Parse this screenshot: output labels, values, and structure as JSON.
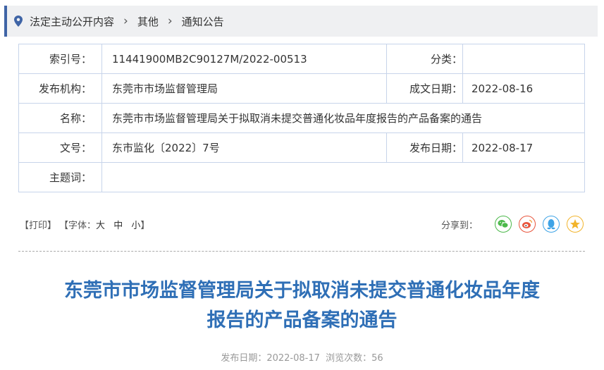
{
  "breadcrumb": [
    "法定主动公开内容",
    "其他",
    "通知公告"
  ],
  "meta": {
    "index_label": "索引号：",
    "index_value": "11441900MB2C90127M/2022-00513",
    "category_label": "分类：",
    "category_value": "",
    "publisher_label": "发布机构：",
    "publisher_value": "东莞市市场监督管理局",
    "written_date_label": "成文日期：",
    "written_date_value": "2022-08-16",
    "name_label": "名称：",
    "name_value": "东莞市市场监督管理局关于拟取消未提交普通化妆品年度报告的产品备案的通告",
    "doc_no_label": "文号：",
    "doc_no_value": "东市监化〔2022〕7号",
    "publish_date_label": "发布日期：",
    "publish_date_value": "2022-08-17",
    "subject_label": "主题词：",
    "subject_value": ""
  },
  "toolbar": {
    "print": "【打印】",
    "font_prefix": "【字体：",
    "font_large": "大",
    "font_medium": "中",
    "font_small": "小",
    "font_suffix": "】",
    "share_label": "分享到：",
    "share_icons": [
      "wechat-icon",
      "weibo-icon",
      "qq-icon",
      "qzone-icon"
    ]
  },
  "article": {
    "title_line1": "东莞市市场监督管理局关于拟取消未提交普通化妆品年度",
    "title_line2": "报告的产品备案的通告",
    "publish_info": "发布日期：2022-08-17  浏览次数：56"
  },
  "colors": {
    "accent": "#3f64a6",
    "title": "#2f6fb6",
    "border": "#c7d4ea"
  }
}
